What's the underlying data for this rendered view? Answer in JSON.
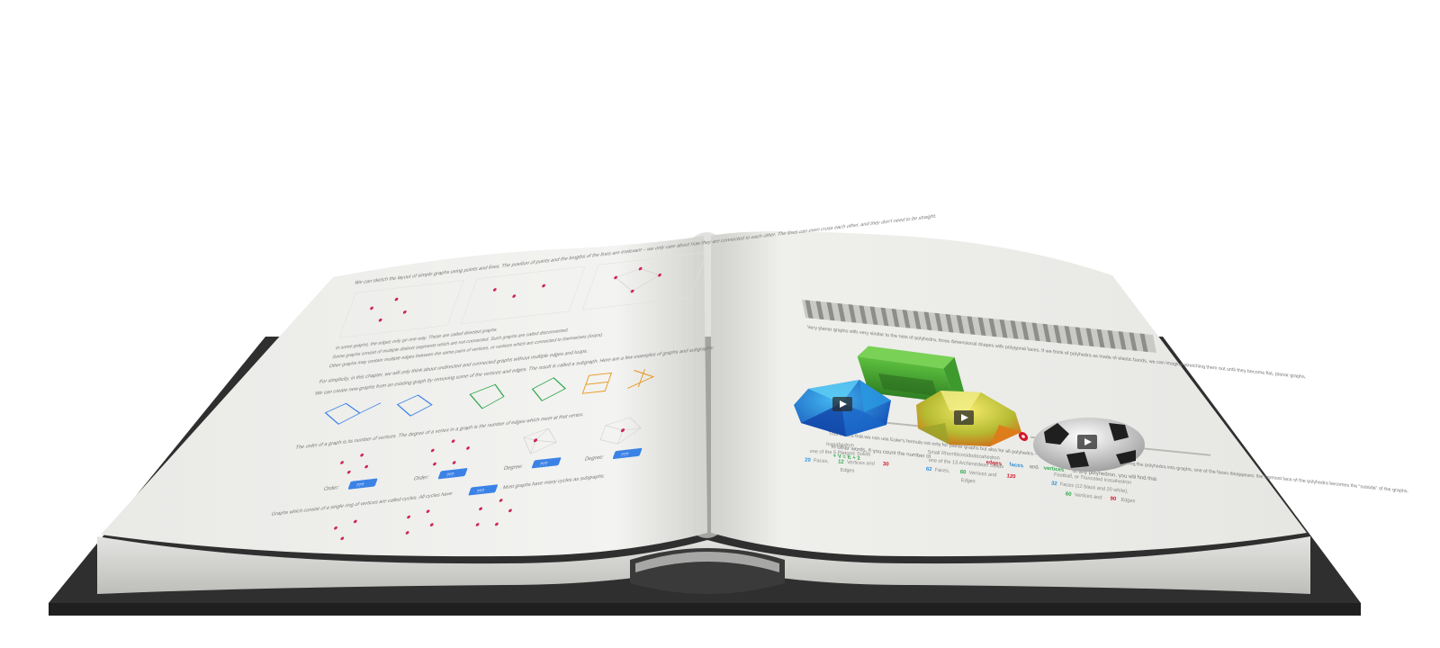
{
  "left_page": {
    "para1": "We can sketch the layout of simple graphs using points and lines. The position of points and the lengths of the lines are irrelevant – we only care about how they are connected to each other. The lines can even cross each other, and they don't need to be straight.",
    "col_a": "In some graphs, the edges only go one way. These are called directed graphs.",
    "col_b": "Some graphs consist of multiple distinct segments which are not connected. Such graphs are called disconnected.",
    "col_c": "Other graphs may contain multiple edges between the same pairs of vertices, or vertices which are connected to themselves (loops).",
    "para2": "For simplicity, in this chapter, we will only think about undirected and connected graphs without multiple edges and loops.",
    "para3": "We can create new graphs from an existing graph by removing some of the vertices and edges. The result is called a subgraph. Here are a few examples of graphs and subgraphs:",
    "order_text": "The order of a graph is its number of vertices. The degree of a vertex in a graph is the number of edges which meet at that vertex.",
    "order_label": "Order:",
    "degree_label": "Degree:",
    "blank": "???",
    "cycle_text": "Graphs which consist of a single ring of vertices are called cycles. All cycles have",
    "cycle_tail": ". Most graphs have many cycles as subgraphs."
  },
  "right_page": {
    "intro": "Very planar graphs with very similar to the nets of polyhedra, three dimensional shapes with polygonal faces. If we think of polyhedra as made of elastic bands, we can imagine stretching them out until they become flat, planar graphs.",
    "euler_text": "This means that we can use Euler's formula not only for planar graphs but also for all polyhedra – with one small difference. When transforming the polyhedra into graphs, one of the faces disappears: the topmost face of the polyhedra becomes the “outside” of the graphs.",
    "count_text_a": "In other words, if you count the number of",
    "edges": "edges",
    "faces": "faces",
    "and": "and",
    "vertices": "vertices",
    "count_text_b": "of any polyhedron, you will find that",
    "formula": "+ V = E + 2",
    "items": [
      {
        "name": "Icosahedron",
        "desc": "one of the 5 Platonic Solids",
        "faces": "20",
        "vertices": "12",
        "edges": "30",
        "w_faces": "Faces,",
        "w_vertices": "Vertices and",
        "w_edges": "Edges"
      },
      {
        "name": "Small Rhombicosidodecahedron",
        "desc": "one of the 13 Archimedean Solids",
        "faces": "62",
        "vertices": "60",
        "edges": "120",
        "w_faces": "Faces,",
        "w_vertices": "Vertices and",
        "w_edges": "Edges"
      },
      {
        "name": "Football, or Truncated Icosahedron",
        "desc": "",
        "faces": "32",
        "vertices": "60",
        "edges": "90",
        "w_faces": "Faces (12 black and 20 white),",
        "w_vertices": "Vertices and",
        "w_edges": "Edges"
      }
    ]
  },
  "colors": {
    "accent_blue": "#3b82e6",
    "faces_blue": "#2f8fd8",
    "vertices_green": "#2fa84a",
    "edges_red": "#d11a2a",
    "vertex_pink": "#d0245c",
    "book_cover": "#333333"
  },
  "icons": [
    "play-icon",
    "play-icon",
    "play-icon",
    "record-icon",
    "record-icon"
  ]
}
